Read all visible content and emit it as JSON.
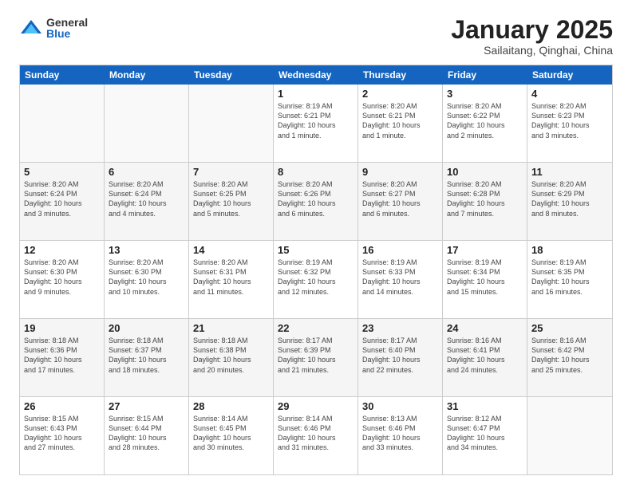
{
  "logo": {
    "general": "General",
    "blue": "Blue"
  },
  "title": "January 2025",
  "subtitle": "Sailaitang, Qinghai, China",
  "day_headers": [
    "Sunday",
    "Monday",
    "Tuesday",
    "Wednesday",
    "Thursday",
    "Friday",
    "Saturday"
  ],
  "weeks": [
    [
      {
        "num": "",
        "info": ""
      },
      {
        "num": "",
        "info": ""
      },
      {
        "num": "",
        "info": ""
      },
      {
        "num": "1",
        "info": "Sunrise: 8:19 AM\nSunset: 6:21 PM\nDaylight: 10 hours\nand 1 minute."
      },
      {
        "num": "2",
        "info": "Sunrise: 8:20 AM\nSunset: 6:21 PM\nDaylight: 10 hours\nand 1 minute."
      },
      {
        "num": "3",
        "info": "Sunrise: 8:20 AM\nSunset: 6:22 PM\nDaylight: 10 hours\nand 2 minutes."
      },
      {
        "num": "4",
        "info": "Sunrise: 8:20 AM\nSunset: 6:23 PM\nDaylight: 10 hours\nand 3 minutes."
      }
    ],
    [
      {
        "num": "5",
        "info": "Sunrise: 8:20 AM\nSunset: 6:24 PM\nDaylight: 10 hours\nand 3 minutes."
      },
      {
        "num": "6",
        "info": "Sunrise: 8:20 AM\nSunset: 6:24 PM\nDaylight: 10 hours\nand 4 minutes."
      },
      {
        "num": "7",
        "info": "Sunrise: 8:20 AM\nSunset: 6:25 PM\nDaylight: 10 hours\nand 5 minutes."
      },
      {
        "num": "8",
        "info": "Sunrise: 8:20 AM\nSunset: 6:26 PM\nDaylight: 10 hours\nand 6 minutes."
      },
      {
        "num": "9",
        "info": "Sunrise: 8:20 AM\nSunset: 6:27 PM\nDaylight: 10 hours\nand 6 minutes."
      },
      {
        "num": "10",
        "info": "Sunrise: 8:20 AM\nSunset: 6:28 PM\nDaylight: 10 hours\nand 7 minutes."
      },
      {
        "num": "11",
        "info": "Sunrise: 8:20 AM\nSunset: 6:29 PM\nDaylight: 10 hours\nand 8 minutes."
      }
    ],
    [
      {
        "num": "12",
        "info": "Sunrise: 8:20 AM\nSunset: 6:30 PM\nDaylight: 10 hours\nand 9 minutes."
      },
      {
        "num": "13",
        "info": "Sunrise: 8:20 AM\nSunset: 6:30 PM\nDaylight: 10 hours\nand 10 minutes."
      },
      {
        "num": "14",
        "info": "Sunrise: 8:20 AM\nSunset: 6:31 PM\nDaylight: 10 hours\nand 11 minutes."
      },
      {
        "num": "15",
        "info": "Sunrise: 8:19 AM\nSunset: 6:32 PM\nDaylight: 10 hours\nand 12 minutes."
      },
      {
        "num": "16",
        "info": "Sunrise: 8:19 AM\nSunset: 6:33 PM\nDaylight: 10 hours\nand 14 minutes."
      },
      {
        "num": "17",
        "info": "Sunrise: 8:19 AM\nSunset: 6:34 PM\nDaylight: 10 hours\nand 15 minutes."
      },
      {
        "num": "18",
        "info": "Sunrise: 8:19 AM\nSunset: 6:35 PM\nDaylight: 10 hours\nand 16 minutes."
      }
    ],
    [
      {
        "num": "19",
        "info": "Sunrise: 8:18 AM\nSunset: 6:36 PM\nDaylight: 10 hours\nand 17 minutes."
      },
      {
        "num": "20",
        "info": "Sunrise: 8:18 AM\nSunset: 6:37 PM\nDaylight: 10 hours\nand 18 minutes."
      },
      {
        "num": "21",
        "info": "Sunrise: 8:18 AM\nSunset: 6:38 PM\nDaylight: 10 hours\nand 20 minutes."
      },
      {
        "num": "22",
        "info": "Sunrise: 8:17 AM\nSunset: 6:39 PM\nDaylight: 10 hours\nand 21 minutes."
      },
      {
        "num": "23",
        "info": "Sunrise: 8:17 AM\nSunset: 6:40 PM\nDaylight: 10 hours\nand 22 minutes."
      },
      {
        "num": "24",
        "info": "Sunrise: 8:16 AM\nSunset: 6:41 PM\nDaylight: 10 hours\nand 24 minutes."
      },
      {
        "num": "25",
        "info": "Sunrise: 8:16 AM\nSunset: 6:42 PM\nDaylight: 10 hours\nand 25 minutes."
      }
    ],
    [
      {
        "num": "26",
        "info": "Sunrise: 8:15 AM\nSunset: 6:43 PM\nDaylight: 10 hours\nand 27 minutes."
      },
      {
        "num": "27",
        "info": "Sunrise: 8:15 AM\nSunset: 6:44 PM\nDaylight: 10 hours\nand 28 minutes."
      },
      {
        "num": "28",
        "info": "Sunrise: 8:14 AM\nSunset: 6:45 PM\nDaylight: 10 hours\nand 30 minutes."
      },
      {
        "num": "29",
        "info": "Sunrise: 8:14 AM\nSunset: 6:46 PM\nDaylight: 10 hours\nand 31 minutes."
      },
      {
        "num": "30",
        "info": "Sunrise: 8:13 AM\nSunset: 6:46 PM\nDaylight: 10 hours\nand 33 minutes."
      },
      {
        "num": "31",
        "info": "Sunrise: 8:12 AM\nSunset: 6:47 PM\nDaylight: 10 hours\nand 34 minutes."
      },
      {
        "num": "",
        "info": ""
      }
    ]
  ]
}
